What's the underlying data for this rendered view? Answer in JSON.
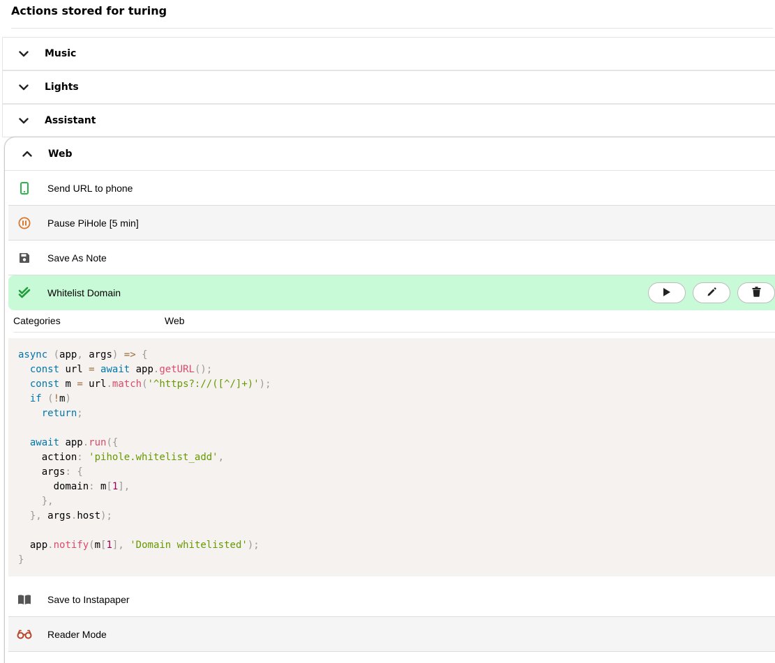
{
  "page": {
    "title": "Actions stored for turing"
  },
  "categories": [
    {
      "label": "Music",
      "expanded": false,
      "icon": "chevron-down-icon"
    },
    {
      "label": "Lights",
      "expanded": false,
      "icon": "chevron-down-icon"
    },
    {
      "label": "Assistant",
      "expanded": false,
      "icon": "chevron-down-icon"
    },
    {
      "label": "Web",
      "expanded": true,
      "icon": "chevron-up-icon"
    }
  ],
  "web_actions": [
    {
      "label": "Send URL to phone",
      "icon": "mobile-phone-icon",
      "icon_color": "#2db34a"
    },
    {
      "label": "Pause PiHole [5 min]",
      "icon": "pause-circle-icon",
      "icon_color": "#d9772b"
    },
    {
      "label": "Save As Note",
      "icon": "floppy-disk-icon",
      "icon_color": "#555555"
    },
    {
      "label": "Whitelist Domain",
      "icon": "double-check-icon",
      "icon_color": "#1f9e3a",
      "selected": true
    },
    {
      "label": "Save to Instapaper",
      "icon": "open-book-icon",
      "icon_color": "#555555"
    },
    {
      "label": "Reader Mode",
      "icon": "glasses-icon",
      "icon_color": "#b8442a"
    }
  ],
  "selected_action": {
    "buttons": {
      "run": "play-icon",
      "edit": "pencil-icon",
      "delete": "trash-icon"
    },
    "meta": {
      "key": "Categories",
      "value": "Web"
    },
    "code_lines": [
      "async (app, args) => {",
      "  const url = await app.getURL();",
      "  const m = url.match('^https?://([^/]+)');",
      "  if (!m)",
      "    return;",
      "",
      "  await app.run({",
      "    action: 'pihole.whitelist_add',",
      "    args: {",
      "      domain: m[1],",
      "    },",
      "  }, args.host);",
      "",
      "  app.notify(m[1], 'Domain whitelisted');",
      "}"
    ]
  },
  "colors": {
    "selected_bg": "#c9fad7",
    "code_bg": "#f5f2f0"
  }
}
